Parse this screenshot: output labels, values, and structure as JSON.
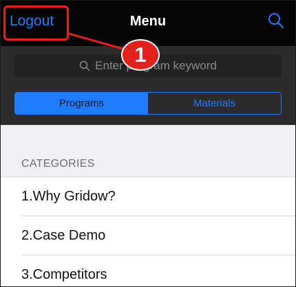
{
  "navbar": {
    "left_label": "Logout",
    "title": "Menu",
    "right_icon": "search-icon"
  },
  "search": {
    "placeholder_visible": "Enter program keyword",
    "icon": "search-icon"
  },
  "segments": [
    {
      "label": "Programs",
      "selected": true
    },
    {
      "label": "Materials",
      "selected": false
    }
  ],
  "section": {
    "header": "CATEGORIES"
  },
  "list": {
    "items": [
      {
        "label": "1.Why Gridow?"
      },
      {
        "label": "2.Case Demo"
      },
      {
        "label": "3.Competitors"
      }
    ]
  },
  "annotation": {
    "number": "1",
    "color": "#e3201b"
  },
  "colors": {
    "accent": "#1f7bff",
    "navbar_bg": "#050505",
    "search_area_bg": "#2b2b2b",
    "content_bg": "#efeff4"
  }
}
